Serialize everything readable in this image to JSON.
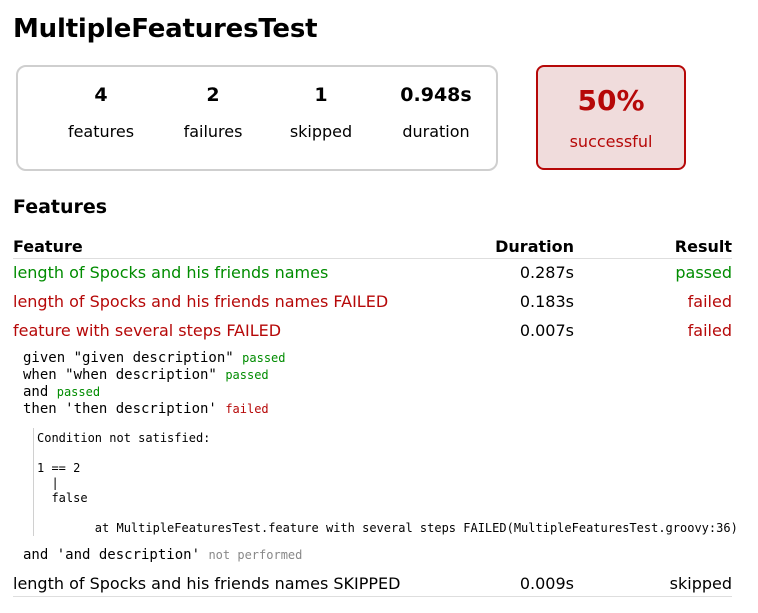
{
  "title": "MultipleFeaturesTest",
  "summary": {
    "features": {
      "value": "4",
      "label": "features"
    },
    "failures": {
      "value": "2",
      "label": "failures"
    },
    "skipped": {
      "value": "1",
      "label": "skipped"
    },
    "duration": {
      "value": "0.948s",
      "label": "duration"
    },
    "success_rate": {
      "value": "50%",
      "label": "successful"
    }
  },
  "features_section": {
    "title": "Features",
    "columns": {
      "feature": "Feature",
      "duration": "Duration",
      "result": "Result"
    },
    "rows": [
      {
        "name": "length of Spocks and his friends names",
        "duration": "0.287s",
        "result": "passed"
      },
      {
        "name": "length of Spocks and his friends names FAILED",
        "duration": "0.183s",
        "result": "failed"
      },
      {
        "name": "feature with several steps FAILED",
        "duration": "0.007s",
        "result": "failed"
      },
      {
        "name": "length of Spocks and his friends names SKIPPED",
        "duration": "0.009s",
        "result": "skipped"
      }
    ],
    "blocks": [
      {
        "text": "given \"given description\"",
        "status": "passed"
      },
      {
        "text": "when \"when description\"",
        "status": "passed"
      },
      {
        "text": "and",
        "status": "passed"
      },
      {
        "text": "then 'then description'",
        "status": "failed"
      },
      {
        "text": "and 'and description'",
        "status": "not performed"
      }
    ],
    "error_lines": [
      "Condition not satisfied:",
      "1 == 2",
      "  |",
      "  false",
      "        at MultipleFeaturesTest.feature with several steps FAILED(MultipleFeaturesTest.groovy:36)"
    ]
  },
  "colors": {
    "passed": "#008c00",
    "failed": "#b60808",
    "not_performed": "#888888",
    "failure_box_bg": "#f0dcdc"
  }
}
